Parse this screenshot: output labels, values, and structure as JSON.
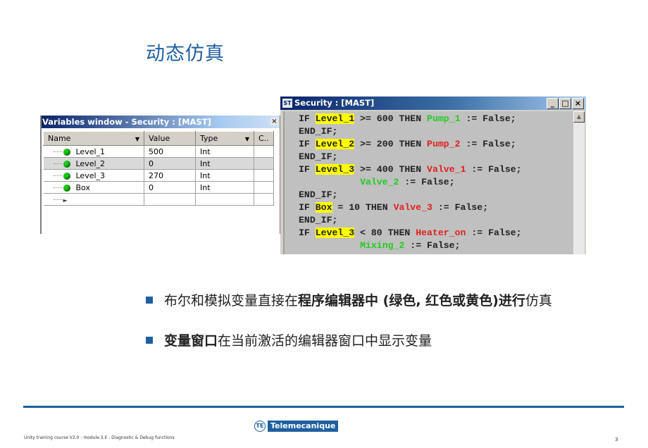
{
  "slide": {
    "title": "动态仿真"
  },
  "variables_window": {
    "title": "Variables window - Security : [MAST]",
    "close_glyph": "×",
    "columns": [
      {
        "label": "Name",
        "has_dropdown": true
      },
      {
        "label": "Value",
        "has_dropdown": false
      },
      {
        "label": "Type",
        "has_dropdown": true
      },
      {
        "label": "C..",
        "has_dropdown": false
      }
    ],
    "dropdown_glyph": "▼",
    "rows": [
      {
        "name": "Level_1",
        "value": "500",
        "type": "Int",
        "selected": false
      },
      {
        "name": "Level_2",
        "value": "0",
        "type": "Int",
        "selected": true
      },
      {
        "name": "Level_3",
        "value": "270",
        "type": "Int",
        "selected": false
      },
      {
        "name": "Box",
        "value": "0",
        "type": "Int",
        "selected": false
      }
    ],
    "new_row_glyph": "►"
  },
  "code_window": {
    "icon_label": "ST",
    "title": "Security : [MAST]",
    "buttons": {
      "minimize": "_",
      "maximize": "□",
      "close": "×"
    },
    "scroll_up_glyph": "▲",
    "colors": {
      "highlight": "#ffff00",
      "green": "#22cc22",
      "red": "#e02020"
    },
    "lines": [
      [
        {
          "t": "IF "
        },
        {
          "t": "Level_1",
          "c": "hl"
        },
        {
          "t": " >= 600 THEN "
        },
        {
          "t": "Pump_1",
          "c": "g"
        },
        {
          "t": " := False;"
        }
      ],
      [
        {
          "t": "END_IF;"
        }
      ],
      [
        {
          "t": "IF "
        },
        {
          "t": "Level_2",
          "c": "hl"
        },
        {
          "t": " >= 200 THEN "
        },
        {
          "t": "Pump_2",
          "c": "r"
        },
        {
          "t": " := False;"
        }
      ],
      [
        {
          "t": "END_IF;"
        }
      ],
      [
        {
          "t": "IF "
        },
        {
          "t": "Level_3",
          "c": "hl"
        },
        {
          "t": " >= 400 THEN "
        },
        {
          "t": "Valve_1",
          "c": "r"
        },
        {
          "t": " := False;"
        }
      ],
      [
        {
          "t": "           "
        },
        {
          "t": "Valve_2",
          "c": "g"
        },
        {
          "t": " := False;"
        }
      ],
      [
        {
          "t": "END_IF;"
        }
      ],
      [
        {
          "t": "IF "
        },
        {
          "t": "Box",
          "c": "hl"
        },
        {
          "t": " = 10 THEN "
        },
        {
          "t": "Valve_3",
          "c": "r"
        },
        {
          "t": " := False;"
        }
      ],
      [
        {
          "t": "END_IF;"
        }
      ],
      [
        {
          "t": "IF "
        },
        {
          "t": "Level_3",
          "c": "hl"
        },
        {
          "t": " < 80 THEN "
        },
        {
          "t": "Heater_on",
          "c": "r"
        },
        {
          "t": " := False;"
        }
      ],
      [
        {
          "t": "           "
        },
        {
          "t": "Mixing_2",
          "c": "g"
        },
        {
          "t": " := False;"
        }
      ]
    ]
  },
  "bullets": [
    {
      "segments": [
        {
          "t": "布尔和模拟变量直接在",
          "bold": false
        },
        {
          "t": "程序编辑器中 (绿色, 红色或黄色)进行",
          "bold": true
        },
        {
          "t": "仿真",
          "bold": false
        }
      ]
    },
    {
      "segments": [
        {
          "t": "变量窗口",
          "bold": true
        },
        {
          "t": "在当前激活的编辑器窗口中显示变量",
          "bold": false
        }
      ]
    }
  ],
  "footer": {
    "course": "Unity training course V2.0 - module 3.E : Diagnostic & Debug functions",
    "logo_text": "Telemecanique",
    "page_number": "3"
  }
}
